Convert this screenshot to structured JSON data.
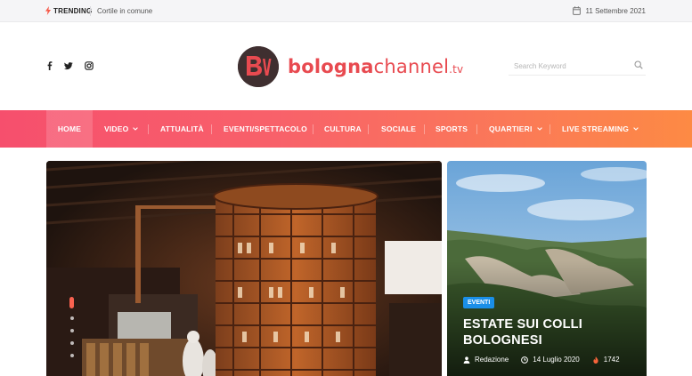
{
  "topbar": {
    "trending_label": "TRENDING",
    "trending_item": "Cortile in comune",
    "date": "11 Settembre 2021"
  },
  "header": {
    "logo_main": "bologna",
    "logo_secondary": "channel",
    "logo_suffix": ".tv",
    "search_placeholder": "Search Keyword",
    "social_icons": [
      "facebook-icon",
      "twitter-icon",
      "instagram-icon"
    ]
  },
  "nav": {
    "items": [
      {
        "label": "HOME",
        "active": true,
        "dropdown": false
      },
      {
        "label": "VIDEO",
        "active": false,
        "dropdown": true
      },
      {
        "label": "ATTUALITÀ",
        "active": false,
        "dropdown": false
      },
      {
        "label": "EVENTI/SPETTACOLO",
        "active": false,
        "dropdown": false
      },
      {
        "label": "CULTURA",
        "active": false,
        "dropdown": false
      },
      {
        "label": "SOCIALE",
        "active": false,
        "dropdown": false
      },
      {
        "label": "SPORTS",
        "active": false,
        "dropdown": false
      },
      {
        "label": "QUARTIERI",
        "active": false,
        "dropdown": true
      },
      {
        "label": "LIVE STREAMING",
        "active": false,
        "dropdown": true
      }
    ]
  },
  "hero": {
    "image": "wine-bottle-rack-tower-museum",
    "slide_count": 5,
    "active_slide": 1
  },
  "side_card": {
    "image": "green-hills-landscape",
    "category": "EVENTI",
    "title": "ESTATE SUI COLLI BOLOGNESI",
    "author": "Redazione",
    "date": "14 Luglio 2020",
    "views": "1742"
  },
  "colors": {
    "accent": "#f64f6d",
    "nav_gradient_end": "#fd8a44",
    "badge": "#1a8fe8",
    "logo": "#e84a50"
  }
}
